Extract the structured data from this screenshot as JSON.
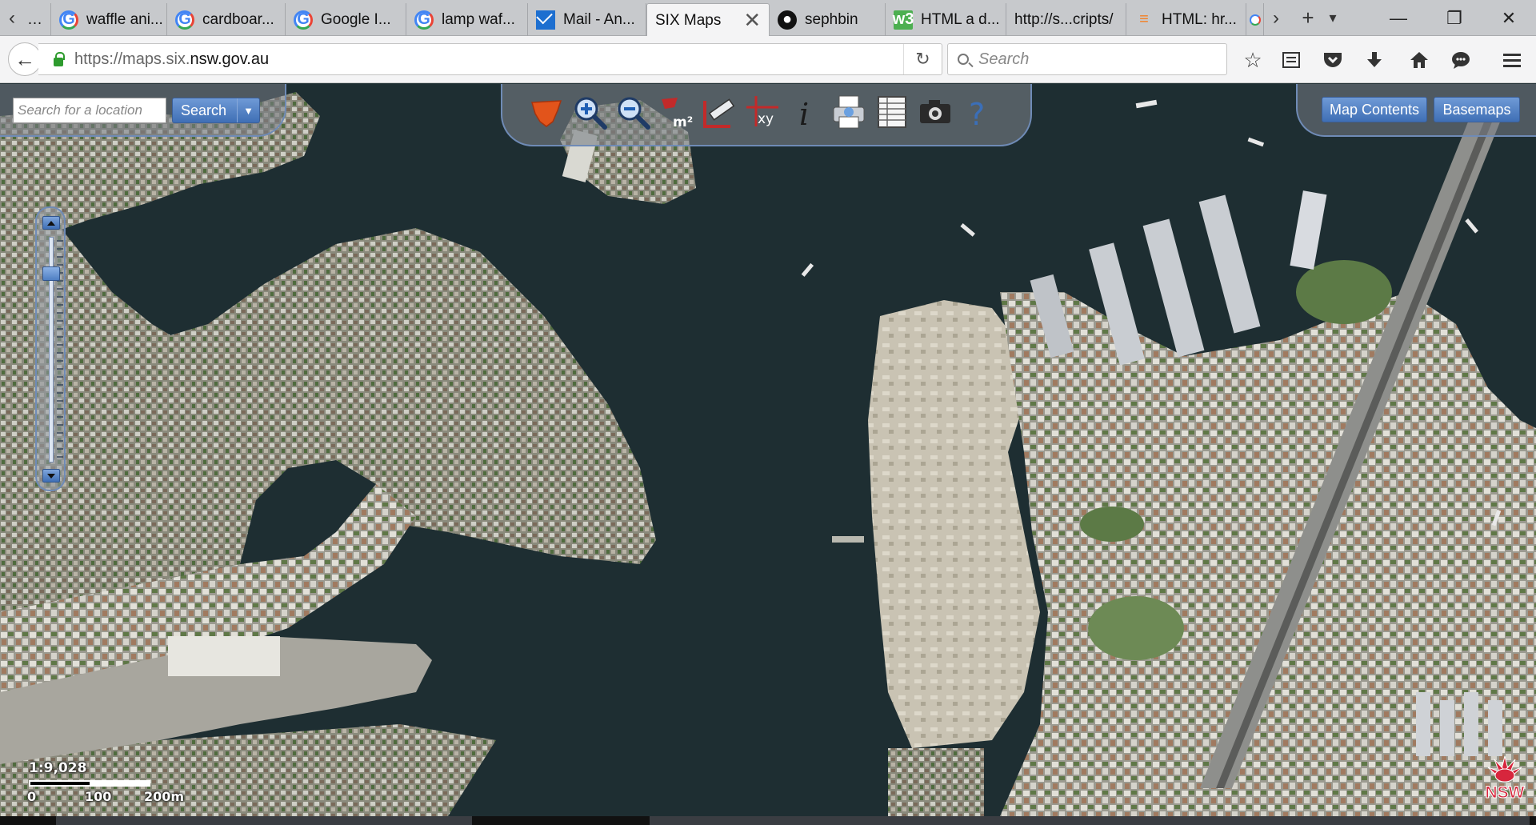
{
  "browser": {
    "tabs": [
      {
        "label": "waffle ani...",
        "icon": "google-icon"
      },
      {
        "label": "cardboar...",
        "icon": "google-icon"
      },
      {
        "label": "Google I...",
        "icon": "google-icon"
      },
      {
        "label": "lamp waf...",
        "icon": "google-icon"
      },
      {
        "label": "Mail - An...",
        "icon": "mail-icon"
      },
      {
        "label": "SIX Maps",
        "icon": "none",
        "active": true
      },
      {
        "label": "sephbin",
        "icon": "github-icon"
      },
      {
        "label": "HTML a d...",
        "icon": "w3schools-icon"
      },
      {
        "label": "http://s...cripts/",
        "icon": "none"
      },
      {
        "label": "HTML: hr...",
        "icon": "stackoverflow-icon"
      }
    ],
    "tab_overflow_left": "‹",
    "tab_overflow_right": "›",
    "new_tab": "+",
    "tab_list": "▾",
    "window_controls": {
      "minimize": "—",
      "restore": "❐",
      "close": "✕"
    },
    "url_prefix": "https://maps.six.",
    "url_host": "nsw.gov.au",
    "search_placeholder": "Search",
    "nav_icons": [
      "bookmark-star-icon",
      "reading-list-icon",
      "pocket-icon",
      "download-icon",
      "home-icon",
      "chat-icon",
      "menu-icon"
    ]
  },
  "map": {
    "location_search": {
      "placeholder": "Search for a location",
      "button_label": "Search"
    },
    "toolbar_tools": [
      "nsw-state-tool-icon",
      "zoom-in-tool-icon",
      "zoom-out-tool-icon",
      "area-measure-tool-icon",
      "distance-measure-tool-icon",
      "xy-coordinate-tool-icon",
      "info-tool-icon",
      "print-tool-icon",
      "table-tool-icon",
      "camera-tool-icon",
      "help-tool-icon"
    ],
    "area_label": "m²",
    "xy_label": "xy",
    "info_label": "i",
    "help_label": "?",
    "map_contents_label": "Map Contents",
    "basemaps_label": "Basemaps",
    "zoom_level": 0.14,
    "scale": {
      "ratio": "1:9,028",
      "labels": [
        "0",
        "100",
        "200m"
      ]
    },
    "logo_text": "NSW",
    "colors": {
      "water": "#1e2e32",
      "panel_border": "#6f8bb6",
      "button": "#4a78bd",
      "nsw_red": "#d7263d"
    }
  }
}
